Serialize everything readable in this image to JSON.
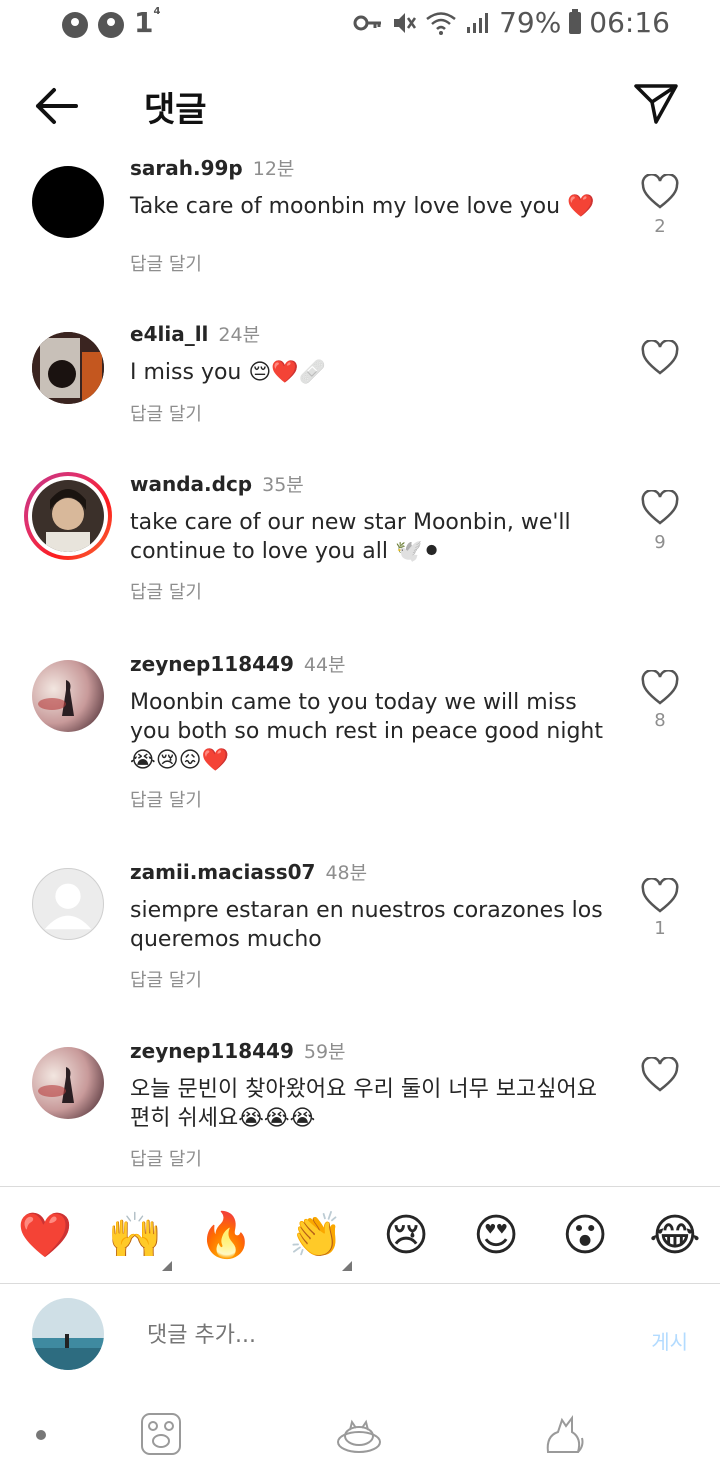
{
  "status_bar": {
    "notif_count": "1",
    "notif_sup": "4",
    "battery": "79%",
    "time": "06:16"
  },
  "header": {
    "title": "댓글"
  },
  "comments": [
    {
      "username": "sarah.99p",
      "time": "12분",
      "text": "Take care of moonbin my love love you ❤️",
      "reply": "답글 달기",
      "likes": "2",
      "avatar_color": "#000000"
    },
    {
      "username": "e4lia_ll",
      "time": "24분",
      "text": "I miss you 😔❤️🩹",
      "reply": "답글 달기",
      "likes": "",
      "avatar_color": "#5a3a2e"
    },
    {
      "username": "wanda.dcp",
      "time": "35분",
      "text": "take care of our new star Moonbin, we'll continue to love you all 🕊️⚫",
      "reply": "답글 달기",
      "likes": "9",
      "avatar_color": "#3b302a"
    },
    {
      "username": "zeynep118449",
      "time": "44분",
      "text": "Moonbin came to you today we will miss you both so much rest in peace good night😭😢😖❤️",
      "reply": "답글 달기",
      "likes": "8",
      "avatar_color": "#8a7070"
    },
    {
      "username": "zamii.maciass07",
      "time": "48분",
      "text": "siempre estaran en nuestros corazones  los queremos mucho",
      "reply": "답글 달기",
      "likes": "1",
      "avatar_color": "#dbdbdb"
    },
    {
      "username": "zeynep118449",
      "time": "59분",
      "text": "오늘 문빈이 찾아왔어요 우리 둘이 너무 보고싶어요 편히 쉬세요😭😭😭",
      "reply": "답글 달기",
      "likes": "",
      "avatar_color": "#8a7070"
    }
  ],
  "emoji_bar": [
    "❤️",
    "🙌",
    "🔥",
    "👏",
    "😢",
    "😍",
    "😮",
    "😂"
  ],
  "composer": {
    "placeholder": "댓글 추가...",
    "post_label": "게시"
  },
  "icons": {
    "back": "arrow-left-icon",
    "send": "paper-plane-icon",
    "like": "heart-outline-icon",
    "nav": [
      "paw-icon",
      "cat-bed-icon",
      "cat-icon"
    ]
  },
  "colors": {
    "muted": "#8e8e8e",
    "post_disabled": "#b3dbff",
    "story_ring": "#e1306c"
  }
}
